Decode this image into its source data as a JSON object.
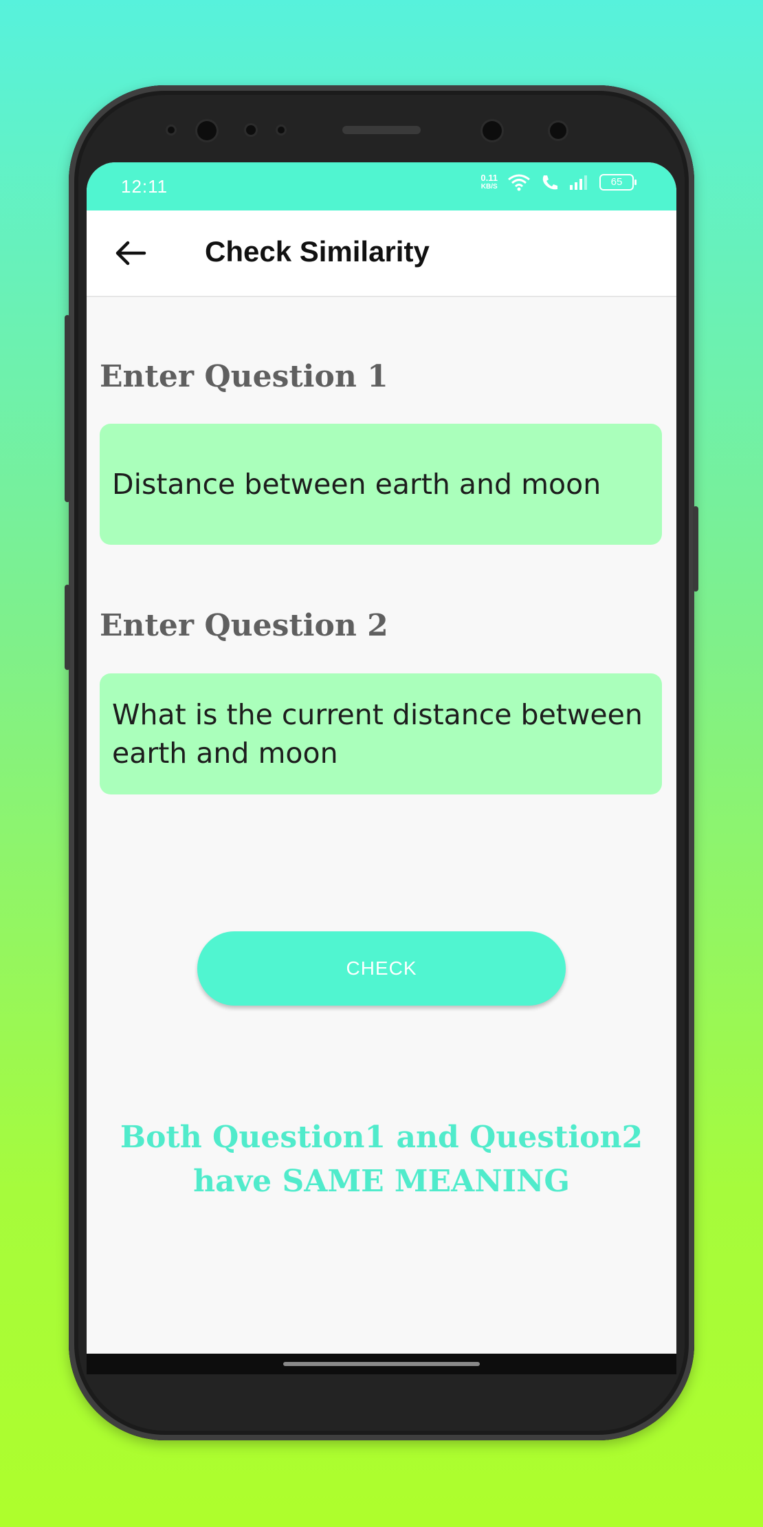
{
  "status_bar": {
    "time": "12:11",
    "net_speed": "0.11",
    "net_unit": "KB/S",
    "battery": "65",
    "icons": [
      "wifi-icon",
      "call-icon",
      "signal-icon",
      "battery-icon"
    ]
  },
  "app_bar": {
    "title": "Check Similarity",
    "back_icon": "arrow-left-icon"
  },
  "form": {
    "q1_label": "Enter Question 1",
    "q1_value": "Distance between earth and moon",
    "q2_label": "Enter Question 2",
    "q2_value": "What is the current distance between earth and moon",
    "check_label": "CHECK"
  },
  "result": {
    "line1": "Both Question1 and Question2",
    "line2": "have SAME MEANING"
  },
  "colors": {
    "accent": "#50f5d0",
    "field_bg": "#aaffbb",
    "result_text": "#50ebcb",
    "label_text": "#5f5f5f"
  }
}
